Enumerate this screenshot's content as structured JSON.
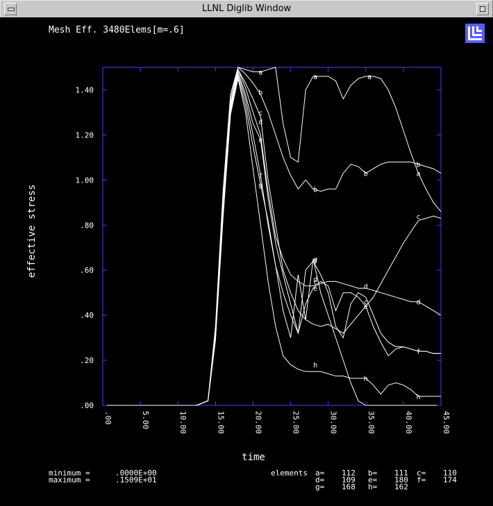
{
  "window": {
    "title": "LLNL Diglib Window"
  },
  "plot_title": "Mesh Eff. 3480Elems[m=.6]",
  "colors": {
    "frame": "#4040ff",
    "curve": "#ffffff",
    "background": "#000000",
    "logo": "#5b5bff"
  },
  "stats": {
    "minimum_label": "minimum =",
    "minimum_value": ".0000E+00",
    "maximum_label": "maximum =",
    "maximum_value": ".1509E+01"
  },
  "elements": {
    "label": "elements",
    "rows": [
      [
        {
          "k": "a=",
          "v": "112"
        },
        {
          "k": "b=",
          "v": "111"
        },
        {
          "k": "c=",
          "v": "110"
        }
      ],
      [
        {
          "k": "d=",
          "v": "109"
        },
        {
          "k": "e=",
          "v": "180"
        },
        {
          "k": "f=",
          "v": "174"
        }
      ],
      [
        {
          "k": "g=",
          "v": "168"
        },
        {
          "k": "h=",
          "v": "162"
        }
      ]
    ]
  },
  "chart_data": {
    "type": "line",
    "title": "Mesh Eff. 3480Elems[m=.6]",
    "xlabel": "time",
    "ylabel": "effective stress",
    "xlim": [
      0,
      45
    ],
    "ylim": [
      0,
      1.5
    ],
    "x_ticks": [
      ".00",
      "5.00",
      "10.00",
      "15.00",
      "20.00",
      "25.00",
      "30.00",
      "35.00",
      "40.00",
      "45.00"
    ],
    "x_tick_values": [
      0,
      5,
      10,
      15,
      20,
      25,
      30,
      35,
      40,
      45
    ],
    "y_ticks": [
      ".00",
      ".20",
      ".40",
      ".60",
      ".80",
      "1.00",
      "1.20",
      "1.40"
    ],
    "y_tick_values": [
      0,
      0.2,
      0.4,
      0.6,
      0.8,
      1.0,
      1.2,
      1.4
    ],
    "grid": false,
    "series": [
      {
        "name": "a",
        "x": [
          0,
          12.5,
          14,
          15,
          16,
          17,
          18,
          19,
          20,
          21,
          22,
          23,
          24,
          25,
          26,
          27,
          28,
          29,
          30,
          31,
          32,
          33,
          34,
          35,
          36,
          37,
          38,
          39,
          40,
          41,
          42,
          43,
          44,
          45
        ],
        "y": [
          0,
          0,
          0.02,
          0.35,
          0.95,
          1.38,
          1.5,
          1.49,
          1.48,
          1.48,
          1.49,
          1.5,
          1.25,
          1.1,
          1.08,
          1.4,
          1.46,
          1.46,
          1.46,
          1.44,
          1.36,
          1.42,
          1.45,
          1.46,
          1.46,
          1.45,
          1.4,
          1.32,
          1.22,
          1.12,
          1.03,
          0.96,
          0.9,
          0.86
        ],
        "markers": [
          {
            "x": 21,
            "y": 1.48
          },
          {
            "x": 28.3,
            "y": 1.46
          },
          {
            "x": 35.5,
            "y": 1.46
          },
          {
            "x": 42,
            "y": 1.03
          }
        ]
      },
      {
        "name": "b",
        "x": [
          0,
          12.5,
          14,
          15,
          16,
          17,
          18,
          19,
          20,
          21,
          22,
          23,
          24,
          25,
          26,
          27,
          28,
          29,
          30,
          31,
          32,
          33,
          34,
          35,
          36,
          37,
          38,
          39,
          40,
          41,
          42,
          43,
          44,
          45
        ],
        "y": [
          0,
          0,
          0.02,
          0.33,
          0.92,
          1.36,
          1.5,
          1.47,
          1.43,
          1.38,
          1.3,
          1.2,
          1.1,
          1.02,
          0.96,
          1.0,
          0.96,
          0.95,
          0.96,
          0.96,
          1.03,
          1.07,
          1.06,
          1.03,
          1.05,
          1.07,
          1.08,
          1.08,
          1.08,
          1.08,
          1.07,
          1.06,
          1.05,
          1.03
        ],
        "markers": [
          {
            "x": 21,
            "y": 1.39
          },
          {
            "x": 28.3,
            "y": 0.96
          },
          {
            "x": 35,
            "y": 1.03
          },
          {
            "x": 42,
            "y": 1.07
          }
        ]
      },
      {
        "name": "c",
        "x": [
          0,
          12.5,
          14,
          15,
          16,
          17,
          18,
          19,
          20,
          21,
          22,
          23,
          24,
          25,
          26,
          27,
          28,
          29,
          30,
          31,
          32,
          33,
          34,
          35,
          36,
          37,
          38,
          39,
          40,
          41,
          42,
          43,
          44,
          45
        ],
        "y": [
          0,
          0,
          0.02,
          0.32,
          0.9,
          1.34,
          1.49,
          1.43,
          1.36,
          1.28,
          1.0,
          0.8,
          0.6,
          0.5,
          0.42,
          0.38,
          0.36,
          0.35,
          0.36,
          0.34,
          0.32,
          0.36,
          0.4,
          0.44,
          0.48,
          0.54,
          0.6,
          0.66,
          0.72,
          0.77,
          0.82,
          0.83,
          0.84,
          0.83
        ],
        "markers": [
          {
            "x": 21,
            "y": 1.3
          },
          {
            "x": 28.3,
            "y": 0.55
          },
          {
            "x": 35,
            "y": 0.46
          },
          {
            "x": 42,
            "y": 0.84
          }
        ]
      },
      {
        "name": "d",
        "x": [
          0,
          12.5,
          14,
          15,
          16,
          17,
          18,
          19,
          20,
          21,
          22,
          23,
          24,
          25,
          26,
          27,
          28,
          29,
          30,
          31,
          32,
          33,
          34,
          35,
          36,
          37,
          38,
          39,
          40,
          41,
          42,
          43,
          44,
          45
        ],
        "y": [
          0,
          0,
          0.02,
          0.31,
          0.88,
          1.33,
          1.49,
          1.41,
          1.3,
          1.2,
          0.95,
          0.75,
          0.65,
          0.58,
          0.55,
          0.53,
          0.53,
          0.54,
          0.55,
          0.55,
          0.54,
          0.53,
          0.52,
          0.52,
          0.51,
          0.5,
          0.49,
          0.48,
          0.47,
          0.46,
          0.46,
          0.44,
          0.42,
          0.4
        ],
        "markers": [
          {
            "x": 21,
            "y": 1.26
          },
          {
            "x": 28.3,
            "y": 0.56
          },
          {
            "x": 35,
            "y": 0.53
          },
          {
            "x": 42,
            "y": 0.46
          }
        ]
      },
      {
        "name": "e",
        "x": [
          0,
          12.5,
          14,
          15,
          16,
          17,
          18,
          19,
          20,
          21,
          22,
          23,
          24,
          25,
          26,
          27,
          28,
          29,
          30,
          31,
          32,
          33,
          34,
          35,
          36,
          37,
          38,
          39,
          40,
          41,
          42,
          43,
          44,
          45
        ],
        "y": [
          0,
          0,
          0.02,
          0.3,
          0.86,
          1.32,
          1.48,
          1.38,
          1.25,
          1.18,
          0.92,
          0.72,
          0.58,
          0.45,
          0.32,
          0.45,
          0.52,
          0.55,
          0.53,
          0.42,
          0.5,
          0.5,
          0.48,
          0.44,
          0.35,
          0.28,
          0.22,
          0.25,
          0.26,
          0.25,
          0.24,
          0.24,
          0.23,
          0.23
        ],
        "markers": [
          {
            "x": 21,
            "y": 1.18
          },
          {
            "x": 28.3,
            "y": 0.52
          },
          {
            "x": 35,
            "y": 0.44
          }
        ]
      },
      {
        "name": "f",
        "x": [
          0,
          12.5,
          14,
          15,
          16,
          17,
          18,
          19,
          20,
          21,
          22,
          23,
          24,
          25,
          26,
          27,
          28,
          29,
          30,
          31,
          32,
          33,
          34,
          35,
          36,
          37,
          38,
          39,
          40,
          41,
          42,
          43,
          44,
          45
        ],
        "y": [
          0,
          0,
          0.02,
          0.3,
          0.85,
          1.31,
          1.47,
          1.36,
          1.2,
          1.02,
          0.8,
          0.62,
          0.5,
          0.4,
          0.32,
          0.6,
          0.64,
          0.58,
          0.5,
          0.35,
          0.3,
          0.45,
          0.5,
          0.48,
          0.4,
          0.32,
          0.28,
          0.26,
          0.26,
          0.25,
          0.24,
          0.24,
          0.23,
          0.23
        ],
        "markers": [
          {
            "x": 21,
            "y": 1.02
          },
          {
            "x": 28.3,
            "y": 0.64
          },
          {
            "x": 42,
            "y": 0.24
          }
        ]
      },
      {
        "name": "g",
        "x": [
          0,
          12.5,
          14,
          15,
          16,
          17,
          18,
          19,
          20,
          21,
          22,
          23,
          24,
          25,
          26,
          27,
          28,
          29,
          30,
          31,
          32,
          33,
          34,
          35,
          36,
          37,
          38,
          39,
          40,
          41,
          42,
          43,
          44,
          45
        ],
        "y": [
          0,
          0,
          0.02,
          0.29,
          0.84,
          1.3,
          1.46,
          1.33,
          1.15,
          0.98,
          0.82,
          0.62,
          0.42,
          0.3,
          0.58,
          0.38,
          0.65,
          0.5,
          0.4,
          0.3,
          0.2,
          0.1,
          0.02,
          0,
          0,
          0,
          0,
          0,
          0,
          0,
          0,
          0,
          0,
          0
        ],
        "markers": [
          {
            "x": 21,
            "y": 0.98
          },
          {
            "x": 28.3,
            "y": 0.65
          }
        ]
      },
      {
        "name": "h",
        "x": [
          0,
          12.5,
          14,
          15,
          16,
          17,
          18,
          19,
          20,
          21,
          22,
          23,
          24,
          25,
          26,
          27,
          28,
          29,
          30,
          31,
          32,
          33,
          34,
          35,
          36,
          37,
          38,
          39,
          40,
          41,
          42,
          43,
          44,
          45
        ],
        "y": [
          0,
          0,
          0.02,
          0.29,
          0.83,
          1.29,
          1.45,
          1.3,
          1.05,
          0.8,
          0.55,
          0.35,
          0.22,
          0.18,
          0.16,
          0.15,
          0.15,
          0.15,
          0.14,
          0.13,
          0.13,
          0.12,
          0.12,
          0.12,
          0.09,
          0.05,
          0.09,
          0.1,
          0.09,
          0.07,
          0.04,
          0.04,
          0.04,
          0.04
        ],
        "markers": [
          {
            "x": 28.3,
            "y": 0.18
          },
          {
            "x": 35,
            "y": 0.12
          },
          {
            "x": 42,
            "y": 0.04
          }
        ]
      }
    ]
  }
}
